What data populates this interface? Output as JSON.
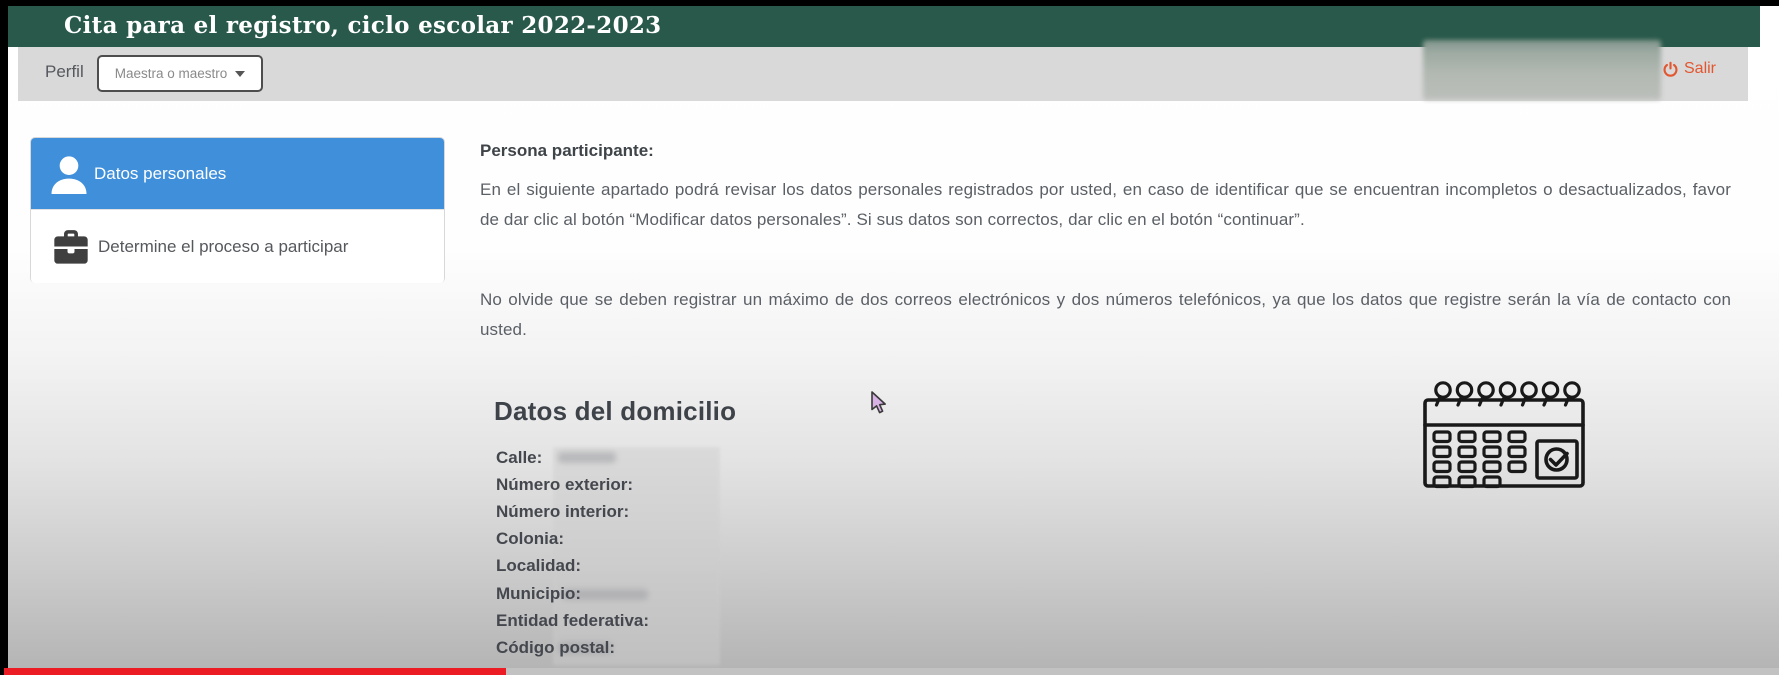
{
  "window": {
    "title": "Cita para el registro, ciclo escolar 2022-2023"
  },
  "toolbar": {
    "profile_label": "Perfil",
    "profile_selected": "Maestra o maestro",
    "logout_label": "Salir"
  },
  "sidebar": {
    "items": [
      {
        "label": "Datos personales",
        "icon": "person",
        "active": true
      },
      {
        "label": "Determine el proceso a participar",
        "icon": "briefcase",
        "active": false
      }
    ]
  },
  "main": {
    "heading": "Persona participante:",
    "paragraph1": "En el siguiente apartado podrá revisar los datos personales registrados por usted, en caso de identificar que se encuentran incompletos o desactualizados, favor de dar clic al botón “Modificar datos personales”. Si sus datos son correctos, dar clic en el botón “continuar”.",
    "paragraph2": "No olvide que se deben registrar un máximo de dos correos electrónicos y dos números telefónicos, ya que los datos que registre serán la vía de contacto con usted.",
    "address": {
      "heading": "Datos del domicilio",
      "fields": [
        "Calle:",
        "Número exterior:",
        "Número interior:",
        "Colonia:",
        "Localidad:",
        "Municipio:",
        "Entidad federativa:",
        "Código postal:"
      ]
    }
  },
  "icons": {
    "logout": "power-icon",
    "profile": "chevron-down-icon",
    "illustration": "calendar-check-icon"
  },
  "colors": {
    "header_green": "#28594a",
    "active_blue": "#3f8fda",
    "logout_orange": "#e25630",
    "progress_red": "#ec1c24",
    "toolbar_gray": "#d9d9d9"
  }
}
